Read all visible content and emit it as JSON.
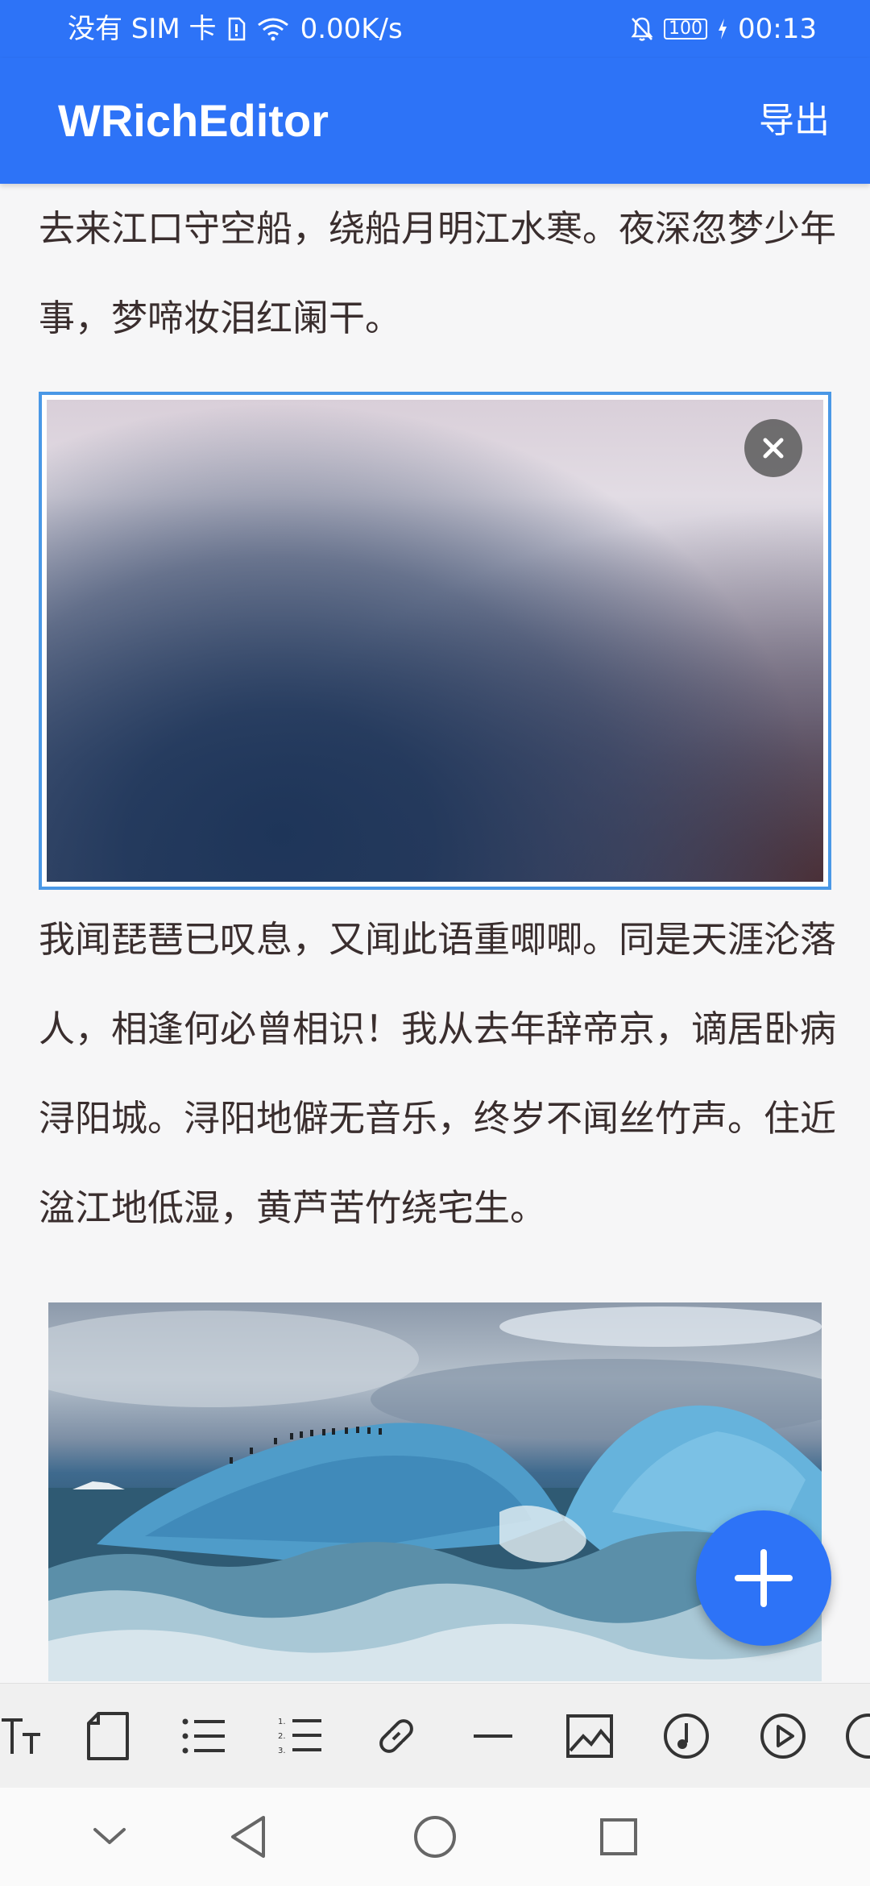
{
  "status_bar": {
    "carrier": "没有 SIM 卡",
    "speed": "0.00K/s",
    "battery": "100",
    "time": "00:13",
    "icons": [
      "sim-card-icon",
      "wifi-icon",
      "bell-off-icon",
      "battery-icon",
      "charging-icon"
    ]
  },
  "app_bar": {
    "title": "WRichEditor",
    "export_label": "导出",
    "color": "#2d73f7"
  },
  "editor": {
    "paragraph1": "去来江口守空船，绕船月明江水寒。夜深忽梦少年事，梦啼妆泪红阑干。",
    "paragraph2": "我闻琵琶已叹息，又闻此语重唧唧。同是天涯沦落人，相逢何必曾相识！我从去年辞帝京，谪居卧病浔阳城。浔阳地僻无音乐，终岁不闻丝竹声。住近湓江地低湿，黄芦苦竹绕宅生。",
    "text_color": "#3a2e2e",
    "selection_border": "#4a98e6"
  },
  "toolbar": {
    "items": [
      "text-size-icon",
      "page-icon",
      "bullet-list-icon",
      "numbered-list-icon",
      "link-icon",
      "divider-line-icon",
      "image-icon",
      "music-icon",
      "video-icon"
    ]
  },
  "nav_bar": {
    "items": [
      "collapse-icon",
      "back-icon",
      "home-icon",
      "recents-icon"
    ]
  }
}
